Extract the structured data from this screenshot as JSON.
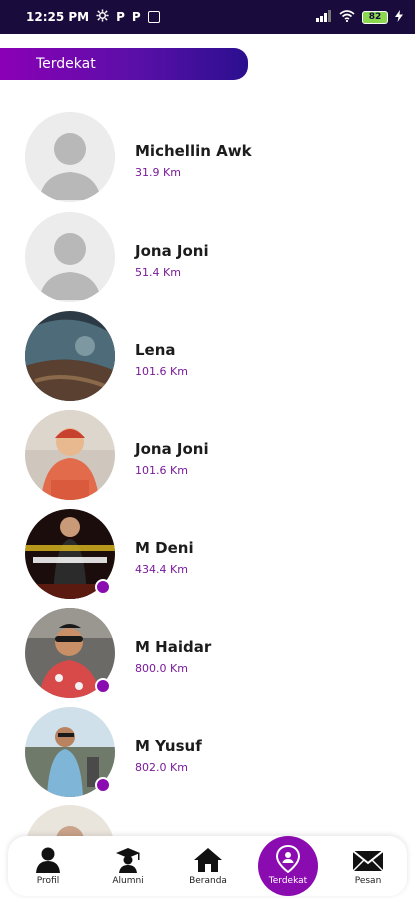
{
  "status_bar": {
    "time": "12:25 PM",
    "badge_1": "P",
    "badge_2": "P",
    "battery": "82"
  },
  "header": {
    "title": "Terdekat"
  },
  "users": [
    {
      "name": "Michellin Awk",
      "distance": "31.9 Km",
      "online": false
    },
    {
      "name": "Jona Joni",
      "distance": "51.4 Km",
      "online": false
    },
    {
      "name": "Lena",
      "distance": "101.6 Km",
      "online": false
    },
    {
      "name": "Jona Joni",
      "distance": "101.6 Km",
      "online": false
    },
    {
      "name": "M Deni",
      "distance": "434.4 Km",
      "online": true
    },
    {
      "name": "M Haidar",
      "distance": "800.0 Km",
      "online": true
    },
    {
      "name": "M Yusuf",
      "distance": "802.0 Km",
      "online": true
    }
  ],
  "nav": {
    "items": [
      {
        "label": "Profil",
        "icon": "person-icon"
      },
      {
        "label": "Alumni",
        "icon": "graduate-icon"
      },
      {
        "label": "Beranda",
        "icon": "home-icon"
      },
      {
        "label": "Terdekat",
        "icon": "location-pin-icon"
      },
      {
        "label": "Pesan",
        "icon": "mail-icon"
      }
    ],
    "active_index": 3,
    "active_color": "#8a0cb0"
  },
  "colors": {
    "accent": "#8a0cb0",
    "distance_text": "#7a1a9a",
    "status_bar": "#1a0b3d"
  }
}
